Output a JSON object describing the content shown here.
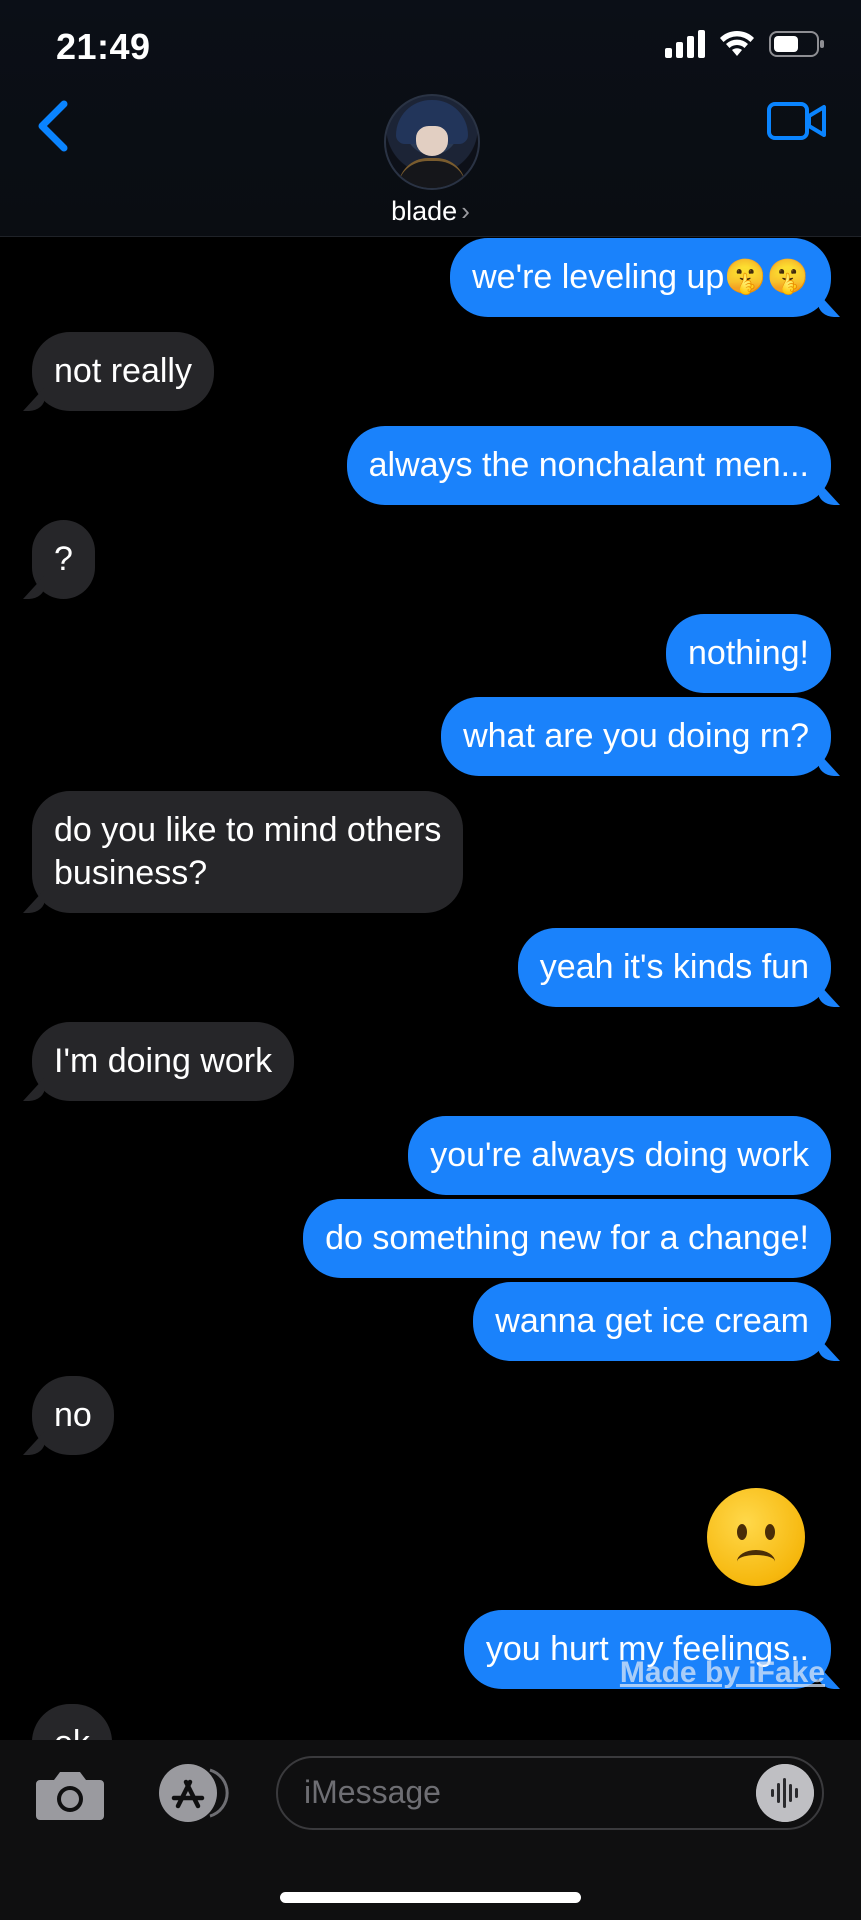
{
  "status_bar": {
    "time": "21:49"
  },
  "header": {
    "contact_name": "blade",
    "chevron": "›"
  },
  "messages": [
    {
      "dir": "sent",
      "text": "we're leveling up🤫🤫"
    },
    {
      "dir": "recv",
      "text": "not really"
    },
    {
      "dir": "sent",
      "text": "always the nonchalant men..."
    },
    {
      "dir": "recv",
      "text": "?"
    },
    {
      "dir": "sent",
      "text": "nothing!"
    },
    {
      "dir": "sent",
      "text": "what are you doing rn?"
    },
    {
      "dir": "recv",
      "text": "do you like to mind others\nbusiness?"
    },
    {
      "dir": "sent",
      "text": "yeah it's kinds fun"
    },
    {
      "dir": "recv",
      "text": "I'm doing work"
    },
    {
      "dir": "sent",
      "text": "you're always doing work"
    },
    {
      "dir": "sent",
      "text": "do something new for a change!"
    },
    {
      "dir": "sent",
      "text": "wanna get ice cream"
    },
    {
      "dir": "recv",
      "text": "no"
    },
    {
      "dir": "sent",
      "text": "you hurt my feelings.."
    },
    {
      "dir": "recv",
      "text": "ok"
    }
  ],
  "big_emoji": "frowning-face-emoji",
  "watermark": "Made by iFake",
  "composer": {
    "placeholder": "iMessage"
  },
  "colors": {
    "sent_bubble": "#1a82fb",
    "received_bubble": "#262629",
    "accent": "#0a84ff"
  }
}
